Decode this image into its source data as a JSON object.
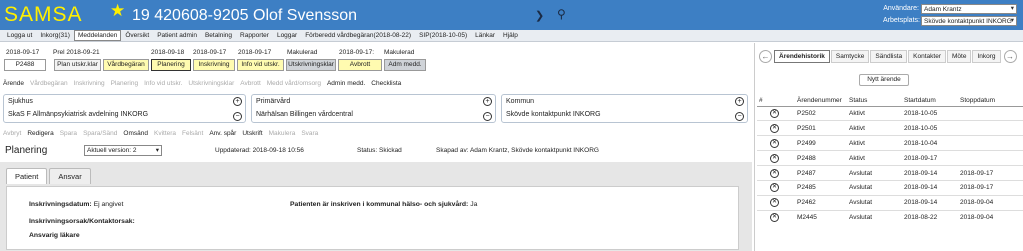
{
  "header": {
    "logo": "SAMSA",
    "patient": "19 420608-9205 Olof Svensson",
    "user_label": "Användare:",
    "user_value": "Adam Krantz",
    "workplace_label": "Arbetsplats:",
    "workplace_value": "Skövde kontaktpunkt INKORG"
  },
  "menu": [
    "Logga ut",
    "Inkorg(31)",
    "Meddelanden",
    "Översikt",
    "Patient admin",
    "Betalning",
    "Rapporter",
    "Loggar",
    "Förberedd vårdbegäran(2018-08-22)",
    "SIP(2018-10-05)",
    "Länkar",
    "Hjälp"
  ],
  "timeline": {
    "dates": [
      "2018-09-17",
      "Prel 2018-09-21",
      "2018-09-18",
      "2018-09-17",
      "2018-09-17",
      "Makulerad",
      "2018-09-17:",
      "Makulerad"
    ],
    "boxes": [
      "P2488",
      "Plan utskr.klar",
      "Vårdbegäran",
      "Planering",
      "Inskrivning",
      "Info vid utskr.",
      "Utskrivningsklar",
      "Avbrott",
      "Adm medd."
    ]
  },
  "toolbar1": [
    "Ärende",
    "Vårdbegäran",
    "Inskrivning",
    "Planering",
    "Info vid utskr.",
    "Utskrivningsklar",
    "Avbrott",
    "Medd vård/omsorg",
    "Admin medd.",
    "Checklista"
  ],
  "cards": {
    "sjukhus_title": "Sjukhus",
    "sjukhus_value": "SkaS F Allmänpsykiatrisk avdelning INKORG",
    "primarvard_title": "Primärvård",
    "primarvard_value": "Närhälsan Billingen vårdcentral",
    "kommun_title": "Kommun",
    "kommun_value": "Skövde kontaktpunkt INKORG"
  },
  "toolbar2": [
    "Avbryt",
    "Redigera",
    "Spara",
    "Spara/Sänd",
    "Omsänd",
    "Kvittera",
    "Felsänt",
    "Anv. spår",
    "Utskrift",
    "Makulera",
    "Svara"
  ],
  "plan": {
    "title": "Planering",
    "version": "Aktuell version: 2",
    "updated": "Uppdaterad: 2018-09-18 10:56",
    "status": "Status: Skickad",
    "created": "Skapad av: Adam Krantz, Skövde kontaktpunkt INKORG"
  },
  "content": {
    "tabs": [
      "Patient",
      "Ansvar"
    ],
    "inskr_label": "Inskrivningsdatum:",
    "inskr_value": "Ej angivet",
    "kommunal_label": "Patienten är inskriven i kommunal hälso- och sjukvård:",
    "kommunal_value": "Ja",
    "orsak_label": "Inskrivningsorsak/Kontaktorsak:",
    "ansvarig_label": "Ansvarig läkare"
  },
  "right": {
    "tabs": [
      "Ärendehistorik",
      "Samtycke",
      "Sändlista",
      "Kontakter",
      "Möte",
      "Inkorg"
    ],
    "new_button": "Nytt ärende",
    "columns": [
      "#",
      "Ärendenummer",
      "Status",
      "Startdatum",
      "Stoppdatum"
    ],
    "rows": [
      [
        "P2502",
        "Aktivt",
        "2018-10-05",
        ""
      ],
      [
        "P2501",
        "Aktivt",
        "2018-10-05",
        ""
      ],
      [
        "P2499",
        "Aktivt",
        "2018-10-04",
        ""
      ],
      [
        "P2488",
        "Aktivt",
        "2018-09-17",
        ""
      ],
      [
        "P2487",
        "Avslutat",
        "2018-09-14",
        "2018-09-17"
      ],
      [
        "P2485",
        "Avslutat",
        "2018-09-14",
        "2018-09-17"
      ],
      [
        "P2462",
        "Avslutat",
        "2018-09-14",
        "2018-09-04"
      ],
      [
        "M2445",
        "Avslutat",
        "2018-08-22",
        "2018-09-04"
      ]
    ]
  },
  "colors": {
    "header_bg": "#3d7fc4",
    "logo": "#fff000",
    "highlight": "#fffbb0"
  }
}
